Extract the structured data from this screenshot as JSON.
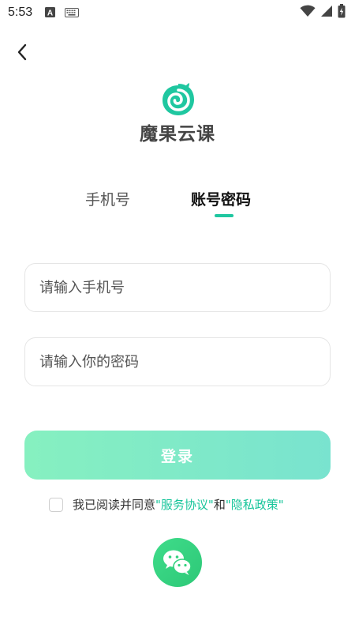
{
  "status_bar": {
    "time": "5:53",
    "icons": [
      "font-a-icon",
      "keyboard-icon",
      "wifi-icon",
      "signal-icon",
      "battery-charging-icon"
    ]
  },
  "nav": {
    "back_icon": "chevron-left-icon"
  },
  "app": {
    "name": "魔果云课",
    "logo_icon": "leaf-swirl-logo",
    "brand_color": "#1fc7a0"
  },
  "tabs": [
    {
      "label": "手机号",
      "active": false
    },
    {
      "label": "账号密码",
      "active": true
    }
  ],
  "form": {
    "phone": {
      "value": "",
      "placeholder": "请输入手机号"
    },
    "password": {
      "value": "",
      "placeholder": "请输入你的密码"
    },
    "login_label": "登录"
  },
  "agreement": {
    "checked": false,
    "prefix": "我已阅读并同意",
    "service_link": "\"服务协议\"",
    "and": "和",
    "privacy_link": "\"隐私政策\""
  },
  "social": {
    "wechat_icon": "wechat-icon",
    "wechat_color": "#34d27f"
  }
}
